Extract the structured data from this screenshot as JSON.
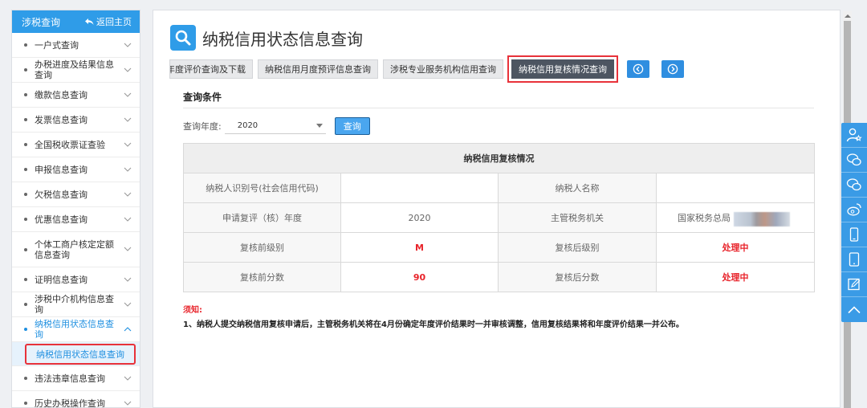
{
  "sidebar": {
    "title": "涉税查询",
    "back_label": "返回主页",
    "items": [
      {
        "label": "一户式查询",
        "chev": "expand"
      },
      {
        "label": "办税进度及结果信息查询",
        "chev": "expand"
      },
      {
        "label": "缴款信息查询",
        "chev": "expand"
      },
      {
        "label": "发票信息查询",
        "chev": "expand"
      },
      {
        "label": "全国税收票证查验",
        "chev": "expand"
      },
      {
        "label": "申报信息查询",
        "chev": "expand"
      },
      {
        "label": "欠税信息查询",
        "chev": "expand"
      },
      {
        "label": "优惠信息查询",
        "chev": "expand"
      },
      {
        "label": "个体工商户核定定额信息查询",
        "chev": "expand"
      },
      {
        "label": "证明信息查询",
        "chev": "expand"
      },
      {
        "label": "涉税中介机构信息查询",
        "chev": "expand"
      },
      {
        "label": "纳税信用状态信息查询",
        "chev": "collapse",
        "active": true
      },
      {
        "label": "违法违章信息查询",
        "chev": "expand"
      },
      {
        "label": "历史办税操作查询",
        "chev": "expand"
      }
    ],
    "sub_item": "纳税信用状态信息查询"
  },
  "page": {
    "title": "纳税信用状态信息查询",
    "tabs": [
      "年度评价查询及下载",
      "纳税信用月度预评信息查询",
      "涉税专业服务机构信用查询",
      "纳税信用复核情况查询"
    ],
    "active_tab": 3
  },
  "query": {
    "section_title": "查询条件",
    "year_label": "查询年度:",
    "year_value": "2020",
    "button_label": "查询"
  },
  "table": {
    "title": "纳税信用复核情况",
    "rows": [
      {
        "l1": "纳税人识别号(社会信用代码)",
        "v1": "",
        "l2": "纳税人名称",
        "v2": ""
      },
      {
        "l1": "申请复评（核）年度",
        "v1": "2020",
        "l2": "主管税务机关",
        "v2": "国家税务总局"
      },
      {
        "l1": "复核前级别",
        "v1": "M",
        "l2": "复核后级别",
        "v2": "处理中"
      },
      {
        "l1": "复核前分数",
        "v1": "90",
        "l2": "复核后分数",
        "v2": "处理中"
      }
    ]
  },
  "notice": {
    "title": "须知:",
    "text": "1、纳税人提交纳税信用复核申请后，主管税务机关将在4月份确定年度评价结果时一并审核调整，信用复核结果将和年度评价结果一并公布。"
  },
  "colors": {
    "primary": "#2f9ce8",
    "highlight_border": "#e8323a",
    "active_tab": "#4d5561",
    "emphasis_red": "#e8232a"
  },
  "icons": {
    "title": "search-icon",
    "back": "return-arrow-icon",
    "float_bar": [
      "user-star-icon",
      "wechat-icon",
      "wechat-icon",
      "weibo-icon",
      "mobile-icon",
      "tablet-icon",
      "edit-icon",
      "chevron-up-icon"
    ]
  }
}
